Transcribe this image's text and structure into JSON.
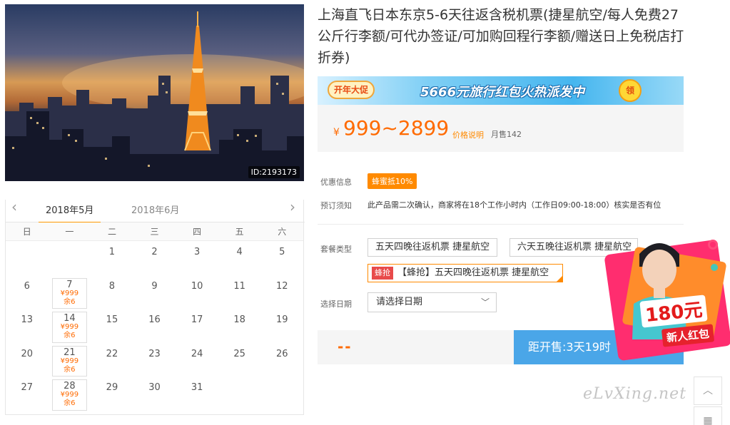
{
  "photo": {
    "id_label": "ID:2193173"
  },
  "calendar": {
    "prev_icon": "chevron-left-icon",
    "next_icon": "chevron-right-icon",
    "months": [
      "2018年5月",
      "2018年6月"
    ],
    "weekdays": [
      "日",
      "一",
      "二",
      "三",
      "四",
      "五",
      "六"
    ],
    "rows": [
      [
        {
          "d": ""
        },
        {
          "d": ""
        },
        {
          "d": "1"
        },
        {
          "d": "2"
        },
        {
          "d": "3"
        },
        {
          "d": "4"
        },
        {
          "d": "5"
        }
      ],
      [
        {
          "d": "6"
        },
        {
          "d": "7",
          "p": "¥999",
          "s": "余6"
        },
        {
          "d": "8"
        },
        {
          "d": "9"
        },
        {
          "d": "10"
        },
        {
          "d": "11"
        },
        {
          "d": "12"
        }
      ],
      [
        {
          "d": "13"
        },
        {
          "d": "14",
          "p": "¥999",
          "s": "余6"
        },
        {
          "d": "15"
        },
        {
          "d": "16"
        },
        {
          "d": "17"
        },
        {
          "d": "18"
        },
        {
          "d": "19"
        }
      ],
      [
        {
          "d": "20"
        },
        {
          "d": "21",
          "p": "¥999",
          "s": "余6"
        },
        {
          "d": "22"
        },
        {
          "d": "23"
        },
        {
          "d": "24"
        },
        {
          "d": "25"
        },
        {
          "d": "26"
        }
      ],
      [
        {
          "d": "27"
        },
        {
          "d": "28",
          "p": "¥999",
          "s": "余6"
        },
        {
          "d": "29"
        },
        {
          "d": "30"
        },
        {
          "d": "31"
        },
        {
          "d": ""
        },
        {
          "d": ""
        }
      ]
    ]
  },
  "product": {
    "title": "上海直飞日本东京5-6天往返含税机票(捷星航空/每人免费27公斤行李额/可代办签证/可加购回程行李额/赠送日上免税店打折券)"
  },
  "banner": {
    "badge": "开年大促",
    "promo": "5666元旅行红包火热派发中",
    "claim": "领"
  },
  "price": {
    "currency": "¥",
    "range": "999~2899",
    "note": "价格说明",
    "sold": "月售142"
  },
  "info": {
    "discount_label": "优惠信息",
    "discount_tag": "蜂蜜抵10%",
    "booking_label": "预订须知",
    "booking_text": "此产品需二次确认，商家将在18个工作小时内（工作日09:00-18:00）核实是否有位"
  },
  "packages": {
    "label": "套餐类型",
    "options": [
      "五天四晚往返机票 捷星航空",
      "六天五晚往返机票 捷星航空"
    ],
    "flash_tag": "蜂抢",
    "flash_option": "【蜂抢】五天四晚往返机票 捷星航空"
  },
  "date": {
    "label": "选择日期",
    "placeholder": "请选择日期"
  },
  "action": {
    "dash": "--",
    "sale_label": "距开售:3天19时"
  },
  "float_promo": {
    "amount": "180元",
    "label": "新人红包"
  },
  "watermark": "eLvXing.net",
  "colors": {
    "accent": "#ff6a00",
    "button_blue": "#4aa6e8",
    "tag_orange": "#ff8a00"
  }
}
